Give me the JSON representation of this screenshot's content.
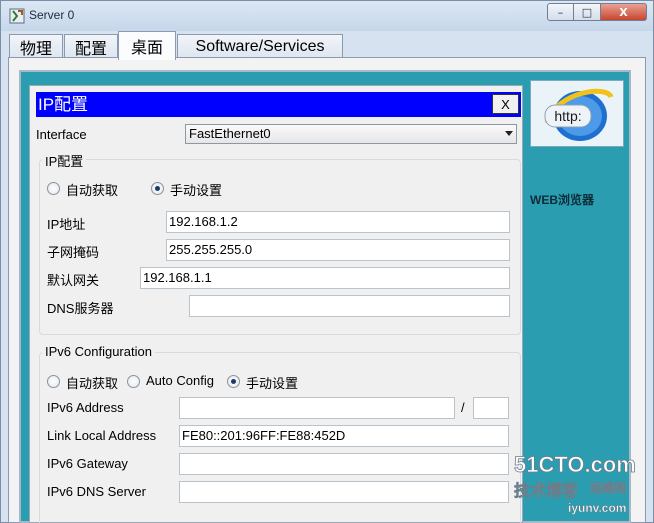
{
  "window": {
    "title": "Server 0",
    "min_glyph": "–",
    "max_glyph": "□",
    "close_glyph": "X"
  },
  "tabs": [
    {
      "label": "物理",
      "active": false
    },
    {
      "label": "配置",
      "active": false
    },
    {
      "label": "桌面",
      "active": true
    },
    {
      "label": "Software/Services",
      "active": false
    }
  ],
  "desktop": {
    "browser_icon_text": "http:",
    "browser_label": "WEB浏览器",
    "background_color": "#2a9eb0"
  },
  "dialog": {
    "title": "IP配置",
    "close_label": "X",
    "title_color": "#0000ff",
    "interface": {
      "label": "Interface",
      "selected": "FastEthernet0"
    },
    "ipv4": {
      "group_title": "IP配置",
      "radio_auto": "自动获取",
      "radio_manual": "手动设置",
      "selected_mode": "manual",
      "ip_label": "IP地址",
      "ip_value": "192.168.1.2",
      "mask_label": "子网掩码",
      "mask_value": "255.255.255.0",
      "gateway_label": "默认网关",
      "gateway_value": "192.168.1.1",
      "dns_label": "DNS服务器",
      "dns_value": ""
    },
    "ipv6": {
      "group_title": "IPv6 Configuration",
      "radio_auto": "自动获取",
      "radio_autoconfig": "Auto Config",
      "radio_manual": "手动设置",
      "selected_mode": "manual",
      "address_label": "IPv6 Address",
      "address_value": "",
      "prefix_separator": "/",
      "prefix_value": "",
      "link_local_label": "Link Local Address",
      "link_local_value": "FE80::201:96FF:FE88:452D",
      "gateway_label": "IPv6 Gateway",
      "gateway_value": "",
      "dns_label": "IPv6 DNS Server",
      "dns_value": ""
    }
  },
  "watermark": {
    "line1": "51CTO.com",
    "line2": "技术博客",
    "line3": "运维网",
    "line4": "iyunv.com"
  }
}
